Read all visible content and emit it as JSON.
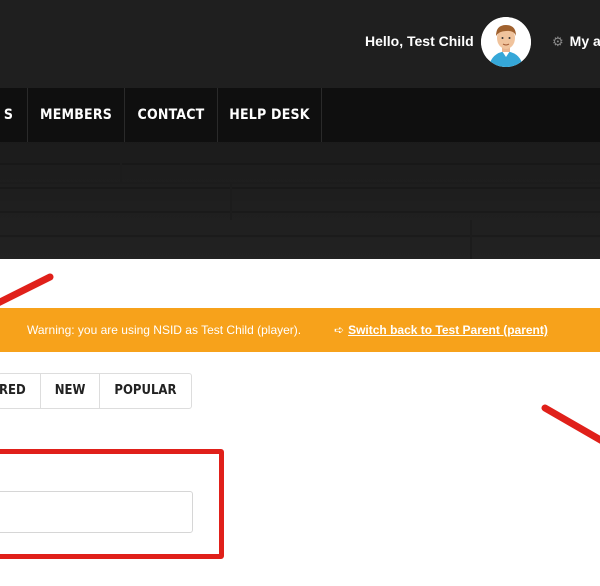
{
  "header": {
    "greeting": "Hello, Test Child",
    "account_label": "My a",
    "account_icon": "gear-icon"
  },
  "nav": {
    "items": [
      {
        "label": "S"
      },
      {
        "label": "MEMBERS"
      },
      {
        "label": "CONTACT"
      },
      {
        "label": "HELP DESK"
      }
    ]
  },
  "warning": {
    "message": "Warning: you are using NSID as Test Child (player).",
    "switch_link": "Switch back to Test Parent (parent)",
    "switch_icon": "sign-out-icon"
  },
  "tabs": {
    "items": [
      {
        "label": "RED"
      },
      {
        "label": "NEW"
      },
      {
        "label": "POPULAR"
      }
    ]
  },
  "input": {
    "value": "",
    "placeholder": ""
  },
  "colors": {
    "header_bg": "#1f1f1f",
    "nav_bg": "#0f0f0f",
    "warning_bg": "#f7a21b",
    "annotation_red": "#e0201a"
  }
}
